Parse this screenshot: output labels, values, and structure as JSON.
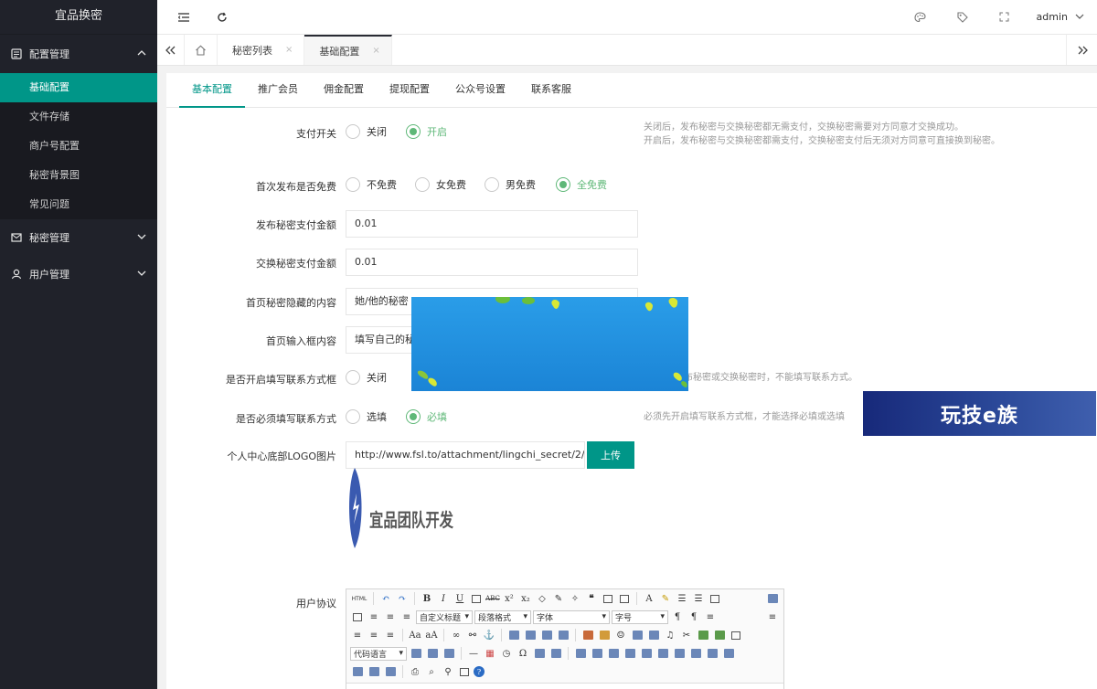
{
  "app": {
    "title": "宜品换密"
  },
  "sidebar": {
    "groups": [
      {
        "label": "配置管理",
        "icon": "config-icon",
        "expanded": true,
        "items": [
          {
            "label": "基础配置",
            "active": true
          },
          {
            "label": "文件存储"
          },
          {
            "label": "商户号配置"
          },
          {
            "label": "秘密背景图"
          },
          {
            "label": "常见问题"
          }
        ]
      },
      {
        "label": "秘密管理",
        "icon": "mail-icon",
        "expanded": false
      },
      {
        "label": "用户管理",
        "icon": "user-icon",
        "expanded": false
      }
    ]
  },
  "topbar": {
    "user": "admin"
  },
  "page_tabs": [
    {
      "label": "秘密列表",
      "close": "×"
    },
    {
      "label": "基础配置",
      "close": "×",
      "active": true
    }
  ],
  "config_tabs": [
    "基本配置",
    "推广会员",
    "佣金配置",
    "提现配置",
    "公众号设置",
    "联系客服"
  ],
  "form": {
    "pay_switch": {
      "label": "支付开关",
      "options": [
        "关闭",
        "开启"
      ],
      "selected": "开启",
      "hint1": "关闭后，发布秘密与交换秘密都无需支付，交换秘密需要对方同意才交换成功。",
      "hint2": "开启后，发布秘密与交换秘密都需支付，交换秘密支付后无须对方同意可直接换到秘密。"
    },
    "first_free": {
      "label": "首次发布是否免费",
      "options": [
        "不免费",
        "女免费",
        "男免费",
        "全免费"
      ],
      "selected": "全免费"
    },
    "publish_fee": {
      "label": "发布秘密支付金额",
      "value": "0.01"
    },
    "exchange_fee": {
      "label": "交换秘密支付金额",
      "value": "0.01"
    },
    "hidden_content": {
      "label": "首页秘密隐藏的内容",
      "value": "她/他的秘密"
    },
    "input_content": {
      "label": "首页输入框内容",
      "value": "填写自己的秘"
    },
    "contact_enable": {
      "label": "是否开启填写联系方式框",
      "options": [
        "关闭"
      ],
      "selected": "",
      "hint": "布秘密或交换秘密时，不能填写联系方式。"
    },
    "contact_required": {
      "label": "是否必须填写联系方式",
      "options": [
        "选填",
        "必填"
      ],
      "selected": "必填",
      "hint": "必须先开启填写联系方式框，才能选择必填或选填"
    },
    "logo": {
      "label": "个人中心底部LOGO图片",
      "value": "http://www.fsl.to/attachment/lingchi_secret/2/initial",
      "button": "上传",
      "preview_text": "宜品团队开发"
    },
    "agreement": {
      "label": "用户协议"
    }
  },
  "editor": {
    "selects": [
      "自定义标题",
      "段落格式",
      "字体",
      "字号",
      "代码语言"
    ],
    "html_btn": "HTML"
  },
  "overlay": {
    "brand": "玩技e族"
  },
  "colors": {
    "accent": "#009688",
    "radio_on": "#5fb878",
    "sidebar": "#20222a"
  }
}
